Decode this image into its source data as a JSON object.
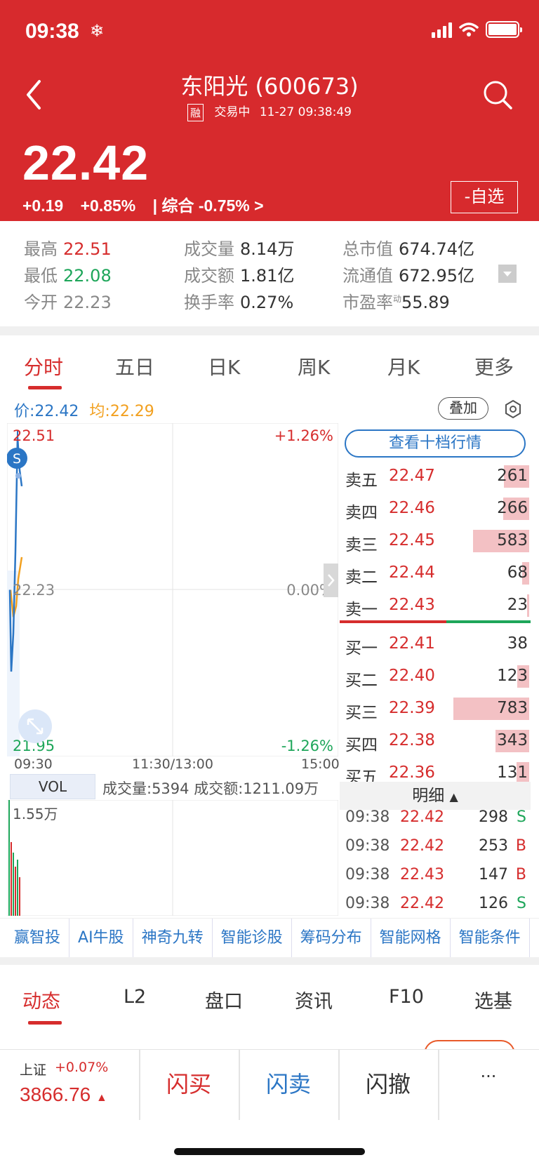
{
  "status_bar": {
    "time": "09:38",
    "snow": "❄"
  },
  "header": {
    "title": "东阳光 (600673)",
    "rong_badge": "融",
    "trade_status": "交易中",
    "timestamp": "11-27 09:38:49",
    "price": "22.42",
    "change": "+0.19",
    "change_pct": "+0.85%",
    "composite": "| 综合 -0.75% >",
    "fav_label": "-自选"
  },
  "stats": {
    "high_label": "最高",
    "high": "22.51",
    "low_label": "最低",
    "low": "22.08",
    "open_label": "今开",
    "open": "22.23",
    "vol_label": "成交量",
    "vol": "8.14万",
    "amount_label": "成交额",
    "amount": "1.81亿",
    "turnover_label": "换手率",
    "turnover": "0.27%",
    "mcap_label": "总市值",
    "mcap": "674.74亿",
    "float_label": "流通值",
    "float": "672.95亿",
    "pe_label": "市盈率",
    "pe_sup": "动",
    "pe": "55.89"
  },
  "tabs": [
    "分时",
    "五日",
    "日K",
    "周K",
    "月K",
    "更多"
  ],
  "legend": {
    "price": "价:22.42",
    "avg": "均:22.29",
    "overlay": "叠加"
  },
  "chart_data": {
    "type": "line",
    "ylim": [
      21.95,
      22.51
    ],
    "y_ticks": {
      "top": "22.51",
      "mid": "22.23",
      "bottom": "21.95"
    },
    "pct_ticks": {
      "top": "+1.26%",
      "mid": "0.00%",
      "bottom": "-1.26%"
    },
    "x_ticks": [
      "09:30",
      "11:30/13:00",
      "15:00"
    ],
    "marker": "S",
    "series": [
      {
        "values": [
          22.23,
          22.08,
          22.15,
          22.3,
          22.51,
          22.45,
          22.42
        ]
      },
      {
        "values": [
          22.23,
          22.18,
          22.2,
          22.25,
          22.29
        ]
      }
    ]
  },
  "volume": {
    "label": "VOL",
    "stats": "成交量:5394 成交额:1211.09万",
    "max": "1.55万"
  },
  "orderbook": {
    "button": "查看十档行情",
    "asks": [
      {
        "label": "卖五",
        "price": "22.47",
        "vol": "261",
        "ratio": 0.33
      },
      {
        "label": "卖四",
        "price": "22.46",
        "vol": "266",
        "ratio": 0.34
      },
      {
        "label": "卖三",
        "price": "22.45",
        "vol": "583",
        "ratio": 0.74
      },
      {
        "label": "卖二",
        "price": "22.44",
        "vol": "68",
        "ratio": 0.09
      },
      {
        "label": "卖一",
        "price": "22.43",
        "vol": "23",
        "ratio": 0.03
      }
    ],
    "bids": [
      {
        "label": "买一",
        "price": "22.41",
        "vol": "38",
        "ratio": 0.0
      },
      {
        "label": "买二",
        "price": "22.40",
        "vol": "123",
        "ratio": 0.16
      },
      {
        "label": "买三",
        "price": "22.39",
        "vol": "783",
        "ratio": 1.0
      },
      {
        "label": "买四",
        "price": "22.38",
        "vol": "343",
        "ratio": 0.44
      },
      {
        "label": "买五",
        "price": "22.36",
        "vol": "131",
        "ratio": 0.17
      }
    ],
    "buy_ratio": 0.6
  },
  "detail": {
    "header": "明细",
    "ticks": [
      {
        "time": "09:38",
        "price": "22.42",
        "vol": "298",
        "side": "S"
      },
      {
        "time": "09:38",
        "price": "22.42",
        "vol": "253",
        "side": "B"
      },
      {
        "time": "09:38",
        "price": "22.43",
        "vol": "147",
        "side": "B"
      },
      {
        "time": "09:38",
        "price": "22.42",
        "vol": "126",
        "side": "S"
      }
    ]
  },
  "features": [
    "赢智投",
    "AI牛股",
    "神奇九转",
    "智能诊股",
    "筹码分布",
    "智能网格",
    "智能条件"
  ],
  "tabs2": [
    "动态",
    "L2",
    "盘口",
    "资讯",
    "F10",
    "选基"
  ],
  "bottom": {
    "index_name": "上证",
    "index_change": "+0.07%",
    "index_value": "3866.76",
    "flash_buy": "闪买",
    "flash_sell": "闪卖",
    "flash_cancel": "闪撤",
    "more": "···"
  },
  "colors": {
    "brand_red": "#d72a2d",
    "up": "#d62d2d",
    "down": "#1ea65a",
    "link_blue": "#2b76c5"
  }
}
